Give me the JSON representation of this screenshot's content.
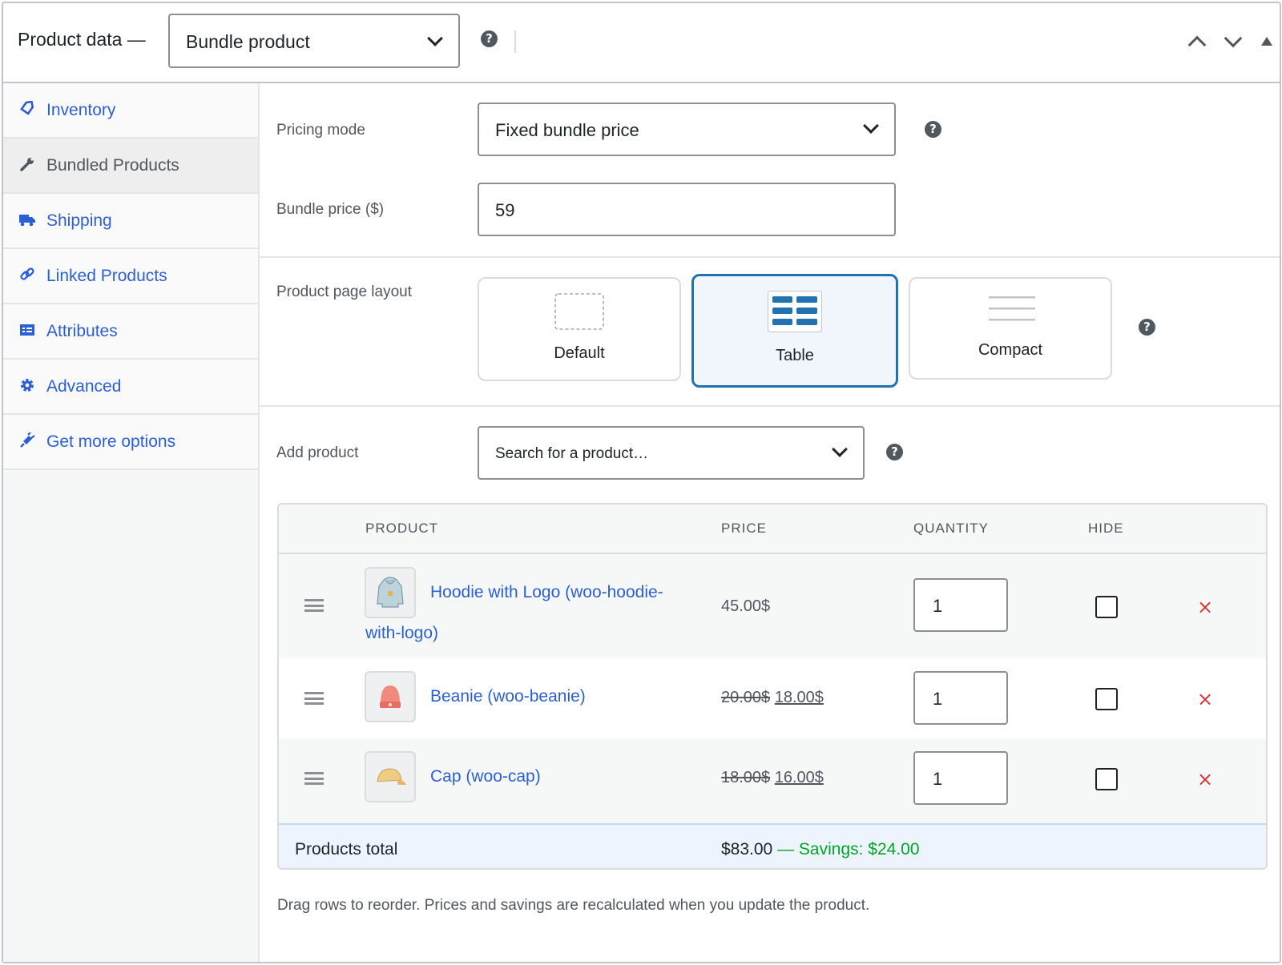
{
  "header": {
    "title": "Product data —",
    "product_type": "Bundle product",
    "controls": [
      "chevron-up-icon",
      "chevron-down-icon",
      "collapse-triangle-icon"
    ]
  },
  "sidebar": {
    "items": [
      {
        "label": "Inventory",
        "icon": "tag-icon",
        "active": false
      },
      {
        "label": "Bundled Products",
        "icon": "wrench-icon",
        "active": true
      },
      {
        "label": "Shipping",
        "icon": "truck-icon",
        "active": false
      },
      {
        "label": "Linked Products",
        "icon": "link-icon",
        "active": false
      },
      {
        "label": "Attributes",
        "icon": "list-card-icon",
        "active": false
      },
      {
        "label": "Advanced",
        "icon": "gear-icon",
        "active": false
      },
      {
        "label": "Get more options",
        "icon": "plugin-icon",
        "active": false
      }
    ]
  },
  "pricing": {
    "mode_label": "Pricing mode",
    "mode_value": "Fixed bundle price",
    "price_label": "Bundle price ($)",
    "price_value": "59"
  },
  "layout": {
    "label": "Product page layout",
    "options": [
      {
        "label": "Default",
        "selected": false
      },
      {
        "label": "Table",
        "selected": true
      },
      {
        "label": "Compact",
        "selected": false
      }
    ]
  },
  "add_product": {
    "label": "Add product",
    "placeholder": "Search for a product…"
  },
  "table": {
    "headers": {
      "product": "PRODUCT",
      "price": "PRICE",
      "quantity": "QUANTITY",
      "hide": "HIDE"
    },
    "rows": [
      {
        "name_line1": "Hoodie with Logo (woo-hoodie-",
        "name_line2": "with-logo)",
        "price": "45.00$",
        "old_price": "",
        "new_price": "",
        "qty": "1",
        "hidden": false,
        "thumb": "hoodie-thumbnail"
      },
      {
        "name_line1": "Beanie (woo-beanie)",
        "name_line2": "",
        "price": "",
        "old_price": "20.00$",
        "new_price": "18.00$",
        "qty": "1",
        "hidden": false,
        "thumb": "beanie-thumbnail"
      },
      {
        "name_line1": "Cap (woo-cap)",
        "name_line2": "",
        "price": "",
        "old_price": "18.00$",
        "new_price": "16.00$",
        "qty": "1",
        "hidden": false,
        "thumb": "cap-thumbnail"
      }
    ],
    "footer": {
      "label": "Products total",
      "total": "$83.00",
      "dash": "—",
      "savings": "Savings: $24.00"
    }
  },
  "note": "Drag rows to reorder. Prices and savings are recalculated when you update the product.",
  "colors": {
    "link": "#2c5fd6",
    "accent": "#2271b1",
    "savings": "#00a32a",
    "remove": "#d63638"
  }
}
